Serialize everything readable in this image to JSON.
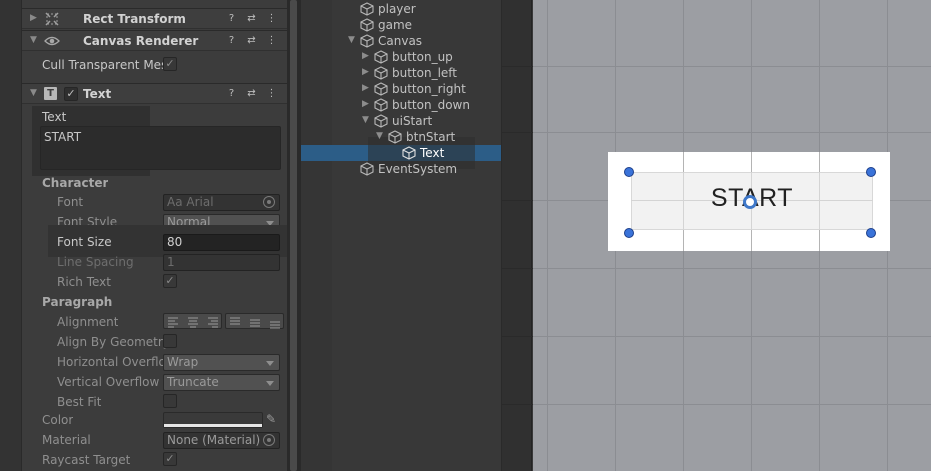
{
  "inspector": {
    "components": {
      "rect_transform": {
        "title": "Rect Transform"
      },
      "canvas_renderer": {
        "title": "Canvas Renderer",
        "cull_label": "Cull Transparent Mes",
        "cull_checked": "✓"
      },
      "text": {
        "title": "Text"
      }
    },
    "text_section": {
      "text_label": "Text",
      "text_value": "START",
      "character_header": "Character",
      "font_label": "Font",
      "font_value": "Aa Arial",
      "font_style_label": "Font Style",
      "font_style_value": "Normal",
      "font_size_label": "Font Size",
      "font_size_value": "80",
      "line_spacing_label": "Line Spacing",
      "line_spacing_value": "1",
      "rich_text_label": "Rich Text",
      "rich_text_checked": "✓",
      "paragraph_header": "Paragraph",
      "alignment_label": "Alignment",
      "align_by_geometry_label": "Align By Geometry",
      "horizontal_overflow_label": "Horizontal Overflow",
      "horizontal_overflow_value": "Wrap",
      "vertical_overflow_label": "Vertical Overflow",
      "vertical_overflow_value": "Truncate",
      "best_fit_label": "Best Fit",
      "color_label": "Color",
      "material_label": "Material",
      "material_value": "None (Material)",
      "raycast_target_label": "Raycast Target",
      "raycast_target_checked": "✓"
    }
  },
  "hierarchy": {
    "items": [
      {
        "name": "player"
      },
      {
        "name": "game"
      },
      {
        "name": "Canvas"
      },
      {
        "name": "button_up"
      },
      {
        "name": "button_left"
      },
      {
        "name": "button_right"
      },
      {
        "name": "button_down"
      },
      {
        "name": "uiStart"
      },
      {
        "name": "btnStart"
      },
      {
        "name": "Text"
      },
      {
        "name": "EventSystem"
      }
    ]
  },
  "scene": {
    "button_text": "START"
  },
  "colors": {
    "selection": "#2c5d87",
    "handle": "#3a73d9",
    "scene_bg": "#9c9ea3"
  }
}
